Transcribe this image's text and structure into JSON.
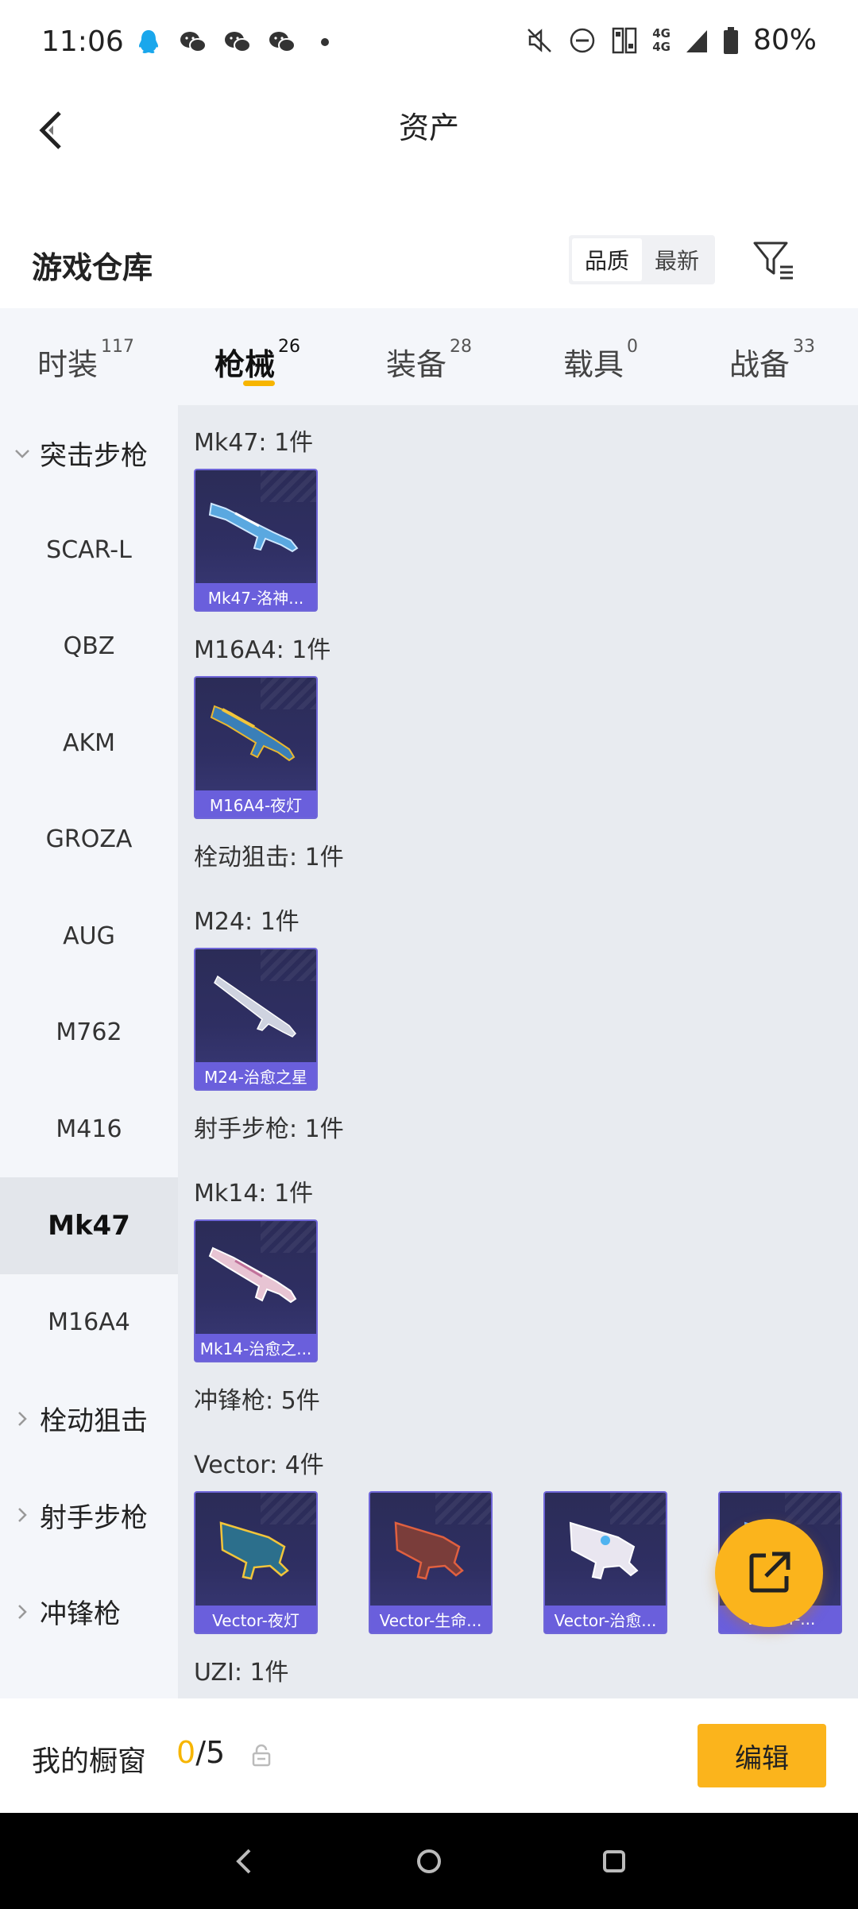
{
  "status_bar": {
    "time": "11:06",
    "left_icons": [
      "qq-icon",
      "wechat-icon",
      "wechat-icon",
      "wechat-icon",
      "dot-icon"
    ],
    "right_icons": [
      "mute-icon",
      "dnd-icon",
      "nfc-icon",
      "signal-4g-icon",
      "signal-bars-icon",
      "battery-icon"
    ],
    "network_top": "4G",
    "network_bottom": "4G",
    "battery": "80%"
  },
  "header": {
    "title": "资产",
    "back_icon": "chevron-left-icon"
  },
  "warehouse": {
    "title": "游戏仓库",
    "sort_options": [
      {
        "label": "品质",
        "active": true
      },
      {
        "label": "最新",
        "active": false
      }
    ],
    "filter_icon": "filter-icon"
  },
  "tabs": [
    {
      "label": "时装",
      "count": "117",
      "active": false
    },
    {
      "label": "枪械",
      "count": "26",
      "active": true
    },
    {
      "label": "装备",
      "count": "28",
      "active": false
    },
    {
      "label": "载具",
      "count": "0",
      "active": false
    },
    {
      "label": "战备",
      "count": "33",
      "active": false
    }
  ],
  "sidebar": {
    "items": [
      {
        "label": "突击步枪",
        "type": "group",
        "expanded": true
      },
      {
        "label": "SCAR-L",
        "type": "item"
      },
      {
        "label": "QBZ",
        "type": "item"
      },
      {
        "label": "AKM",
        "type": "item"
      },
      {
        "label": "GROZA",
        "type": "item"
      },
      {
        "label": "AUG",
        "type": "item"
      },
      {
        "label": "M762",
        "type": "item"
      },
      {
        "label": "M416",
        "type": "item"
      },
      {
        "label": "Mk47",
        "type": "item",
        "active": true
      },
      {
        "label": "M16A4",
        "type": "item"
      },
      {
        "label": "栓动狙击",
        "type": "group",
        "expanded": false
      },
      {
        "label": "射手步枪",
        "type": "group",
        "expanded": false
      },
      {
        "label": "冲锋枪",
        "type": "group",
        "expanded": false
      }
    ]
  },
  "content": {
    "sections": [
      {
        "title": "Mk47: 1件",
        "cards": [
          "Mk47-洛神..."
        ]
      },
      {
        "title": "M16A4: 1件",
        "cards": [
          "M16A4-夜灯"
        ]
      },
      {
        "title": "栓动狙击: 1件",
        "cards": []
      },
      {
        "title": "M24: 1件",
        "cards": [
          "M24-治愈之星"
        ]
      },
      {
        "title": "射手步枪: 1件",
        "cards": []
      },
      {
        "title": "Mk14: 1件",
        "cards": [
          "Mk14-治愈之..."
        ]
      },
      {
        "title": "冲锋枪: 5件",
        "cards": []
      },
      {
        "title": "Vector: 4件",
        "cards": [
          "Vector-夜灯",
          "Vector-生命...",
          "Vector-治愈...",
          "Vector-..."
        ]
      },
      {
        "title": "UZI: 1件",
        "cards": []
      }
    ]
  },
  "fab": {
    "icon": "share-external-icon"
  },
  "bottom_bar": {
    "title": "我的橱窗",
    "count_current": "0",
    "count_total": "/5",
    "lock_icon": "lock-icon",
    "edit_label": "编辑"
  },
  "nav_bar": {
    "buttons": [
      "back-icon",
      "home-icon",
      "recents-icon"
    ]
  },
  "colors": {
    "accent": "#fbb41c",
    "card_bg": "#2f2f63",
    "card_label_bg": "#6a5fdc",
    "content_bg": "#e8ebf0",
    "sidebar_bg": "#f4f6fa"
  }
}
